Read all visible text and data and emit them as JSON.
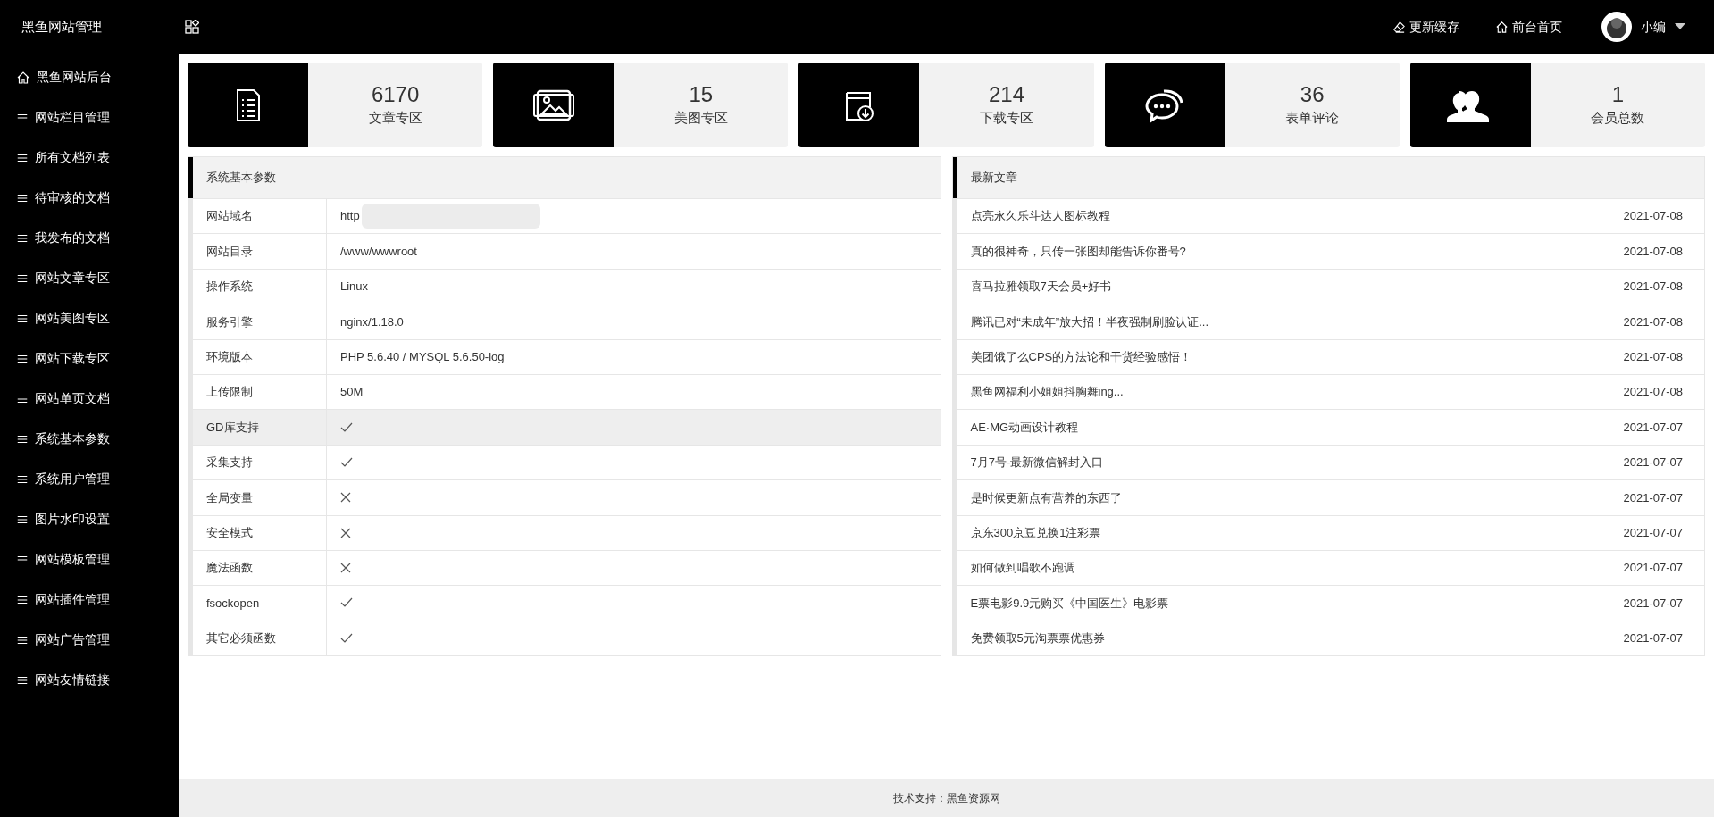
{
  "brand": "黑鱼网站管理",
  "topbar": {
    "actions": [
      {
        "label": "更新缓存"
      },
      {
        "label": "前台首页"
      }
    ],
    "user": {
      "name": "小编"
    }
  },
  "sidebar": {
    "items": [
      "黑鱼网站后台",
      "网站栏目管理",
      "所有文档列表",
      "待审核的文档",
      "我发布的文档",
      "网站文章专区",
      "网站美图专区",
      "网站下载专区",
      "网站单页文档",
      "系统基本参数",
      "系统用户管理",
      "图片水印设置",
      "网站模板管理",
      "网站插件管理",
      "网站广告管理",
      "网站友情链接"
    ]
  },
  "stats": [
    {
      "value": "6170",
      "label": "文章专区"
    },
    {
      "value": "15",
      "label": "美图专区"
    },
    {
      "value": "214",
      "label": "下载专区"
    },
    {
      "value": "36",
      "label": "表单评论"
    },
    {
      "value": "1",
      "label": "会员总数"
    }
  ],
  "system_panel": {
    "title": "系统基本参数",
    "rows": [
      {
        "label": "网站域名",
        "kind": "redacted",
        "value": "http",
        "highlighted": false
      },
      {
        "label": "网站目录",
        "kind": "text",
        "value": "/www/wwwroot",
        "highlighted": false
      },
      {
        "label": "操作系统",
        "kind": "text",
        "value": "Linux",
        "highlighted": false
      },
      {
        "label": "服务引擎",
        "kind": "text",
        "value": "nginx/1.18.0",
        "highlighted": false
      },
      {
        "label": "环境版本",
        "kind": "text",
        "value": "PHP 5.6.40 / MYSQL 5.6.50-log",
        "highlighted": false
      },
      {
        "label": "上传限制",
        "kind": "text",
        "value": "50M",
        "highlighted": false
      },
      {
        "label": "GD库支持",
        "kind": "check",
        "highlighted": true
      },
      {
        "label": "采集支持",
        "kind": "check",
        "highlighted": false
      },
      {
        "label": "全局变量",
        "kind": "cross",
        "highlighted": false
      },
      {
        "label": "安全模式",
        "kind": "cross",
        "highlighted": false
      },
      {
        "label": "魔法函数",
        "kind": "cross",
        "highlighted": false
      },
      {
        "label": "fsockopen",
        "kind": "check",
        "highlighted": false
      },
      {
        "label": "其它必须函数",
        "kind": "check",
        "highlighted": false
      }
    ]
  },
  "articles_panel": {
    "title": "最新文章",
    "rows": [
      {
        "title": "点亮永久乐斗达人图标教程",
        "date": "2021-07-08"
      },
      {
        "title": "真的很神奇，只传一张图却能告诉你番号?",
        "date": "2021-07-08"
      },
      {
        "title": "喜马拉雅领取7天会员+好书",
        "date": "2021-07-08"
      },
      {
        "title": "腾讯已对“未成年”放大招！半夜强制刷脸认证...",
        "date": "2021-07-08"
      },
      {
        "title": "美团饿了么CPS的方法论和干货经验感悟！",
        "date": "2021-07-08"
      },
      {
        "title": "黑鱼网福利小姐姐抖胸舞ing...",
        "date": "2021-07-08"
      },
      {
        "title": "AE·MG动画设计教程",
        "date": "2021-07-07"
      },
      {
        "title": "7月7号-最新微信解封入口",
        "date": "2021-07-07"
      },
      {
        "title": "是时候更新点有营养的东西了",
        "date": "2021-07-07"
      },
      {
        "title": "京东300京豆兑换1注彩票",
        "date": "2021-07-07"
      },
      {
        "title": "如何做到唱歌不跑调",
        "date": "2021-07-07"
      },
      {
        "title": "E票电影9.9元购买《中国医生》电影票",
        "date": "2021-07-07"
      },
      {
        "title": "免费领取5元淘票票优惠券",
        "date": "2021-07-07"
      }
    ]
  },
  "footer": "技术支持：黑鱼资源网"
}
